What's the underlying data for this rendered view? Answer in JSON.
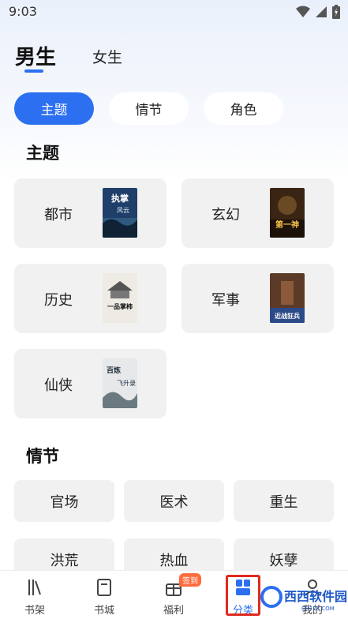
{
  "status_bar": {
    "time": "9:03"
  },
  "gender_tabs": {
    "male": "男生",
    "female": "女生"
  },
  "category_chips": [
    {
      "label": "主题",
      "active": true
    },
    {
      "label": "情节",
      "active": false
    },
    {
      "label": "角色",
      "active": false
    }
  ],
  "sections": {
    "theme_title": "主题",
    "plot_title": "情节"
  },
  "genres": [
    {
      "name": "都市",
      "cover": {
        "title": "执掌",
        "subtitle": "风云",
        "color": "#1f3f6a"
      }
    },
    {
      "name": "玄幻",
      "cover": {
        "title": "第一神",
        "subtitle": "",
        "color": "#3a2514"
      }
    },
    {
      "name": "历史",
      "cover": {
        "title": "一品掌柿",
        "subtitle": "",
        "color": "#d8d4cc"
      }
    },
    {
      "name": "军事",
      "cover": {
        "title": "近战狂兵",
        "subtitle": "",
        "color": "#5b3a28"
      }
    },
    {
      "name": "仙侠",
      "cover": {
        "title": "百炼飞升录",
        "subtitle": "",
        "color": "#e6e8ea"
      }
    }
  ],
  "plots": [
    "官场",
    "医术",
    "重生",
    "洪荒",
    "热血",
    "妖孽"
  ],
  "bottom_nav": [
    {
      "label": "书架",
      "icon": "bookshelf-icon"
    },
    {
      "label": "书城",
      "icon": "book-icon"
    },
    {
      "label": "福利",
      "icon": "gift-icon",
      "badge": "签到"
    },
    {
      "label": "分类",
      "icon": "category-icon",
      "active": true
    },
    {
      "label": "我的",
      "icon": "profile-icon"
    }
  ],
  "watermark": {
    "brand": "西西软件园",
    "domain": "CR173.COM"
  },
  "colors": {
    "accent": "#2c6ff0",
    "card_bg": "#f1f1f1",
    "badge": "#ff6b3d",
    "highlight": "#e02b1e"
  }
}
